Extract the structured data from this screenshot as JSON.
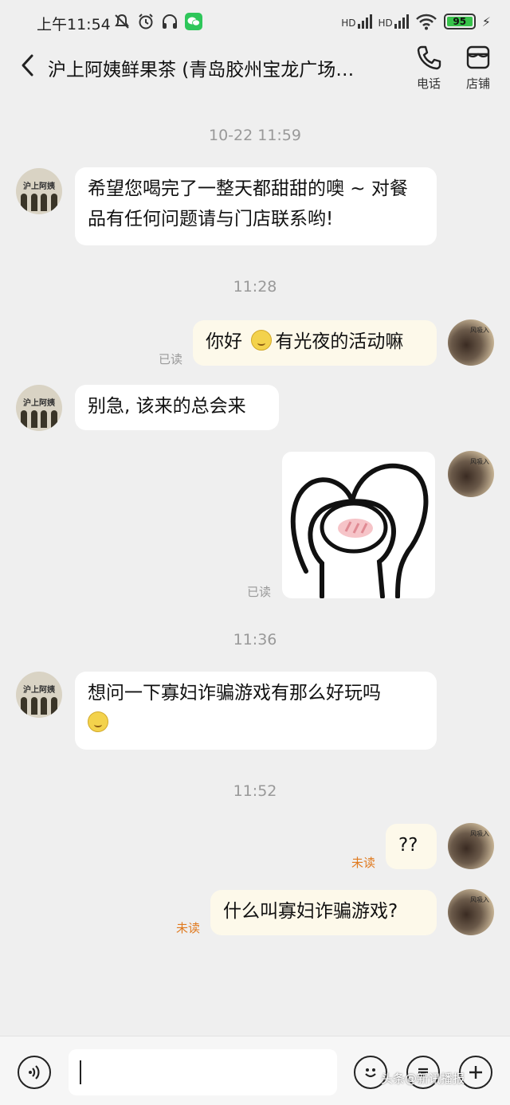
{
  "status_bar": {
    "time": "上午11:54",
    "battery": "95",
    "signal_labels": [
      "HD",
      "HD"
    ]
  },
  "header": {
    "title": "沪上阿姨鲜果茶 (青岛胶州宝龙广场…",
    "phone_label": "电话",
    "store_label": "店铺"
  },
  "messages": {
    "ts1": "10-22 11:59",
    "m1": "希望您喝完了一整天都甜甜的噢 ~ 对餐品有任何问题请与门店联系哟!",
    "ts2": "11:28",
    "m2_pre": "你好",
    "m2_post": "有光夜的活动嘛",
    "m2_state": "已读",
    "m3": "别急, 该来的总会来",
    "m4_state": "已读",
    "ts3": "11:36",
    "m5": "想问一下寡妇诈骗游戏有那么好玩吗",
    "ts4": "11:52",
    "m6": "??",
    "m6_state": "未读",
    "m7": "什么叫寡妇诈骗游戏?",
    "m7_state": "未读"
  },
  "avatars": {
    "shop_brand": "沪上阿姨",
    "user_tag": "风吸入"
  },
  "input": {
    "value": "",
    "placeholder": ""
  },
  "watermark": "头条@新讯播报",
  "colors": {
    "background": "#efefef",
    "incoming_bubble": "#ffffff",
    "outgoing_bubble": "#fdf9ea",
    "unread": "#e07a1f",
    "wechat": "#2ec65a",
    "battery": "#37c24a"
  },
  "icons": [
    "mute-icon",
    "alarm-icon",
    "headphone-icon",
    "wechat-icon",
    "signal-icon",
    "wifi-icon",
    "battery-icon",
    "charging-icon",
    "back-arrow-icon",
    "phone-icon",
    "store-icon",
    "voice-icon",
    "emoji-icon",
    "quick-reply-icon",
    "plus-icon"
  ]
}
